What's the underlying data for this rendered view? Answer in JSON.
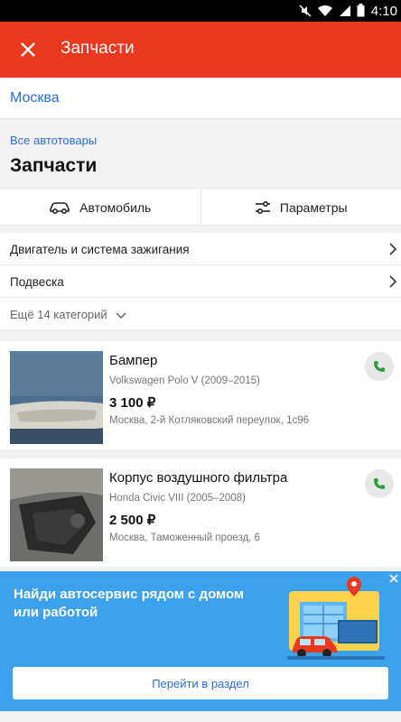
{
  "status_bar": {
    "time": "4:10"
  },
  "app_bar": {
    "title": "Запчасти"
  },
  "location": {
    "city": "Москва"
  },
  "category": {
    "parent_link": "Все автотовары",
    "title": "Запчасти"
  },
  "filters": {
    "car_label": "Автомобиль",
    "params_label": "Параметры"
  },
  "subcategories": [
    {
      "label": "Двигатель и система зажигания"
    },
    {
      "label": "Подвеска"
    }
  ],
  "more_categories": {
    "label": "Ещё 14 категорий"
  },
  "listings": [
    {
      "name": "Бампер",
      "model": "Volkswagen Polo V (2009–2015)",
      "price": "3 100 ₽",
      "address": "Москва, 2-й Котляковский переулок, 1с96"
    },
    {
      "name": "Корпус воздушного фильтра",
      "model": "Honda Civic VIII (2005–2008)",
      "price": "2 500 ₽",
      "address": "Москва, Таможенный проезд, 6"
    }
  ],
  "promo_banner": {
    "text": "Найди автосервис рядом с домом или работой",
    "button_label": "Перейти в раздел"
  },
  "colors": {
    "accent": "#e8381d",
    "link": "#2b6fd6",
    "banner": "#3da2ee",
    "call": "#2e9e3a"
  },
  "icons": [
    "close-icon",
    "car-icon",
    "sliders-icon",
    "chevron-right-icon",
    "chevron-down-icon",
    "phone-icon",
    "wifi-icon",
    "battery-icon"
  ]
}
